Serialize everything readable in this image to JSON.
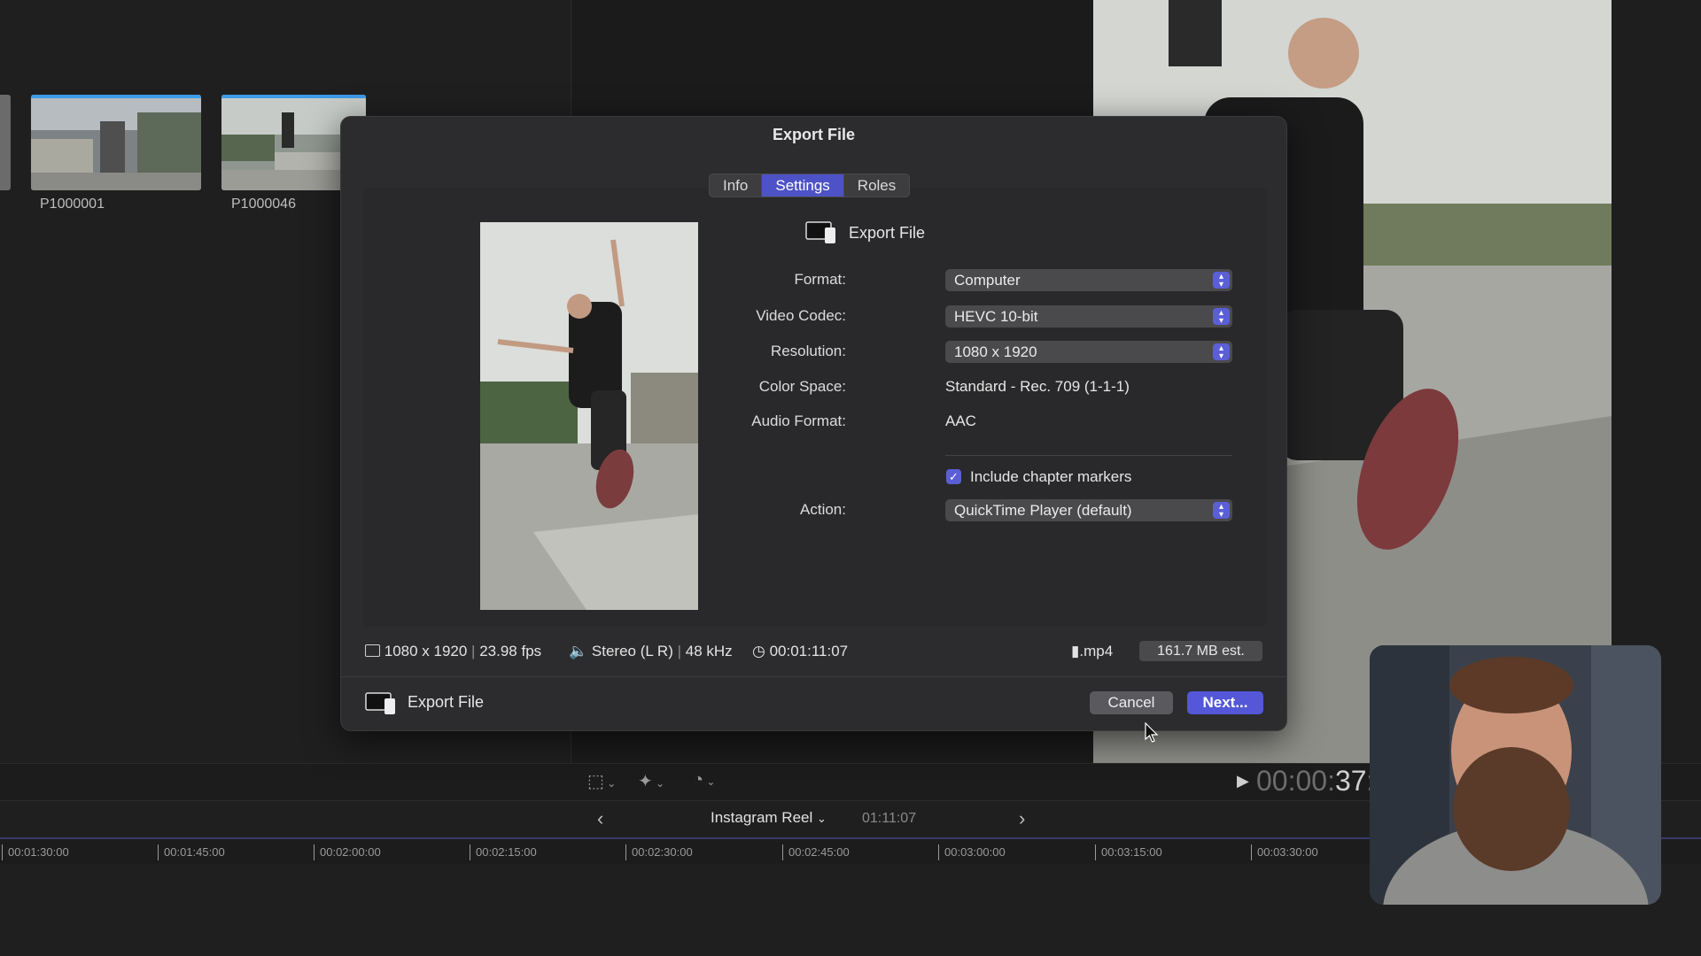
{
  "browser": {
    "clips": [
      {
        "name": "P1000001"
      },
      {
        "name": "P1000046"
      }
    ]
  },
  "dialog": {
    "title": "Export File",
    "tabs": [
      {
        "label": "Info",
        "active": false
      },
      {
        "label": "Settings",
        "active": true
      },
      {
        "label": "Roles",
        "active": false
      }
    ],
    "destination": "Export File",
    "fields": {
      "format": {
        "label": "Format:",
        "value": "Computer"
      },
      "video_codec": {
        "label": "Video Codec:",
        "value": "HEVC 10-bit"
      },
      "resolution": {
        "label": "Resolution:",
        "value": "1080 x 1920"
      },
      "color_space": {
        "label": "Color Space:",
        "value": "Standard - Rec. 709 (1-1-1)"
      },
      "audio_format": {
        "label": "Audio Format:",
        "value": "AAC"
      },
      "chapter_markers": {
        "label": "Include chapter markers",
        "checked": true
      },
      "action": {
        "label": "Action:",
        "value": "QuickTime Player (default)"
      }
    },
    "summary": {
      "resolution": "1080 x 1920",
      "fps": "23.98 fps",
      "audio": "Stereo (L R)",
      "sample_rate": "48 kHz",
      "duration": "00:01:11:07",
      "extension": ".mp4",
      "size_estimate": "161.7 MB est."
    },
    "footer": {
      "destination": "Export File",
      "cancel_label": "Cancel",
      "next_label": "Next..."
    }
  },
  "viewer": {
    "timecode_dim": "00:00:",
    "timecode_bright": "37:"
  },
  "timeline": {
    "project_name": "Instagram Reel",
    "duration": "01:11:07",
    "ticks": [
      "00:01:30:00",
      "00:01:45:00",
      "00:02:00:00",
      "00:02:15:00",
      "00:02:30:00",
      "00:02:45:00",
      "00:03:00:00",
      "00:03:15:00",
      "00:03:30:00"
    ]
  },
  "colors": {
    "accent": "#5357d8",
    "clip_bar": "#3e9be8",
    "dialog_bg": "#2c2c2e"
  }
}
